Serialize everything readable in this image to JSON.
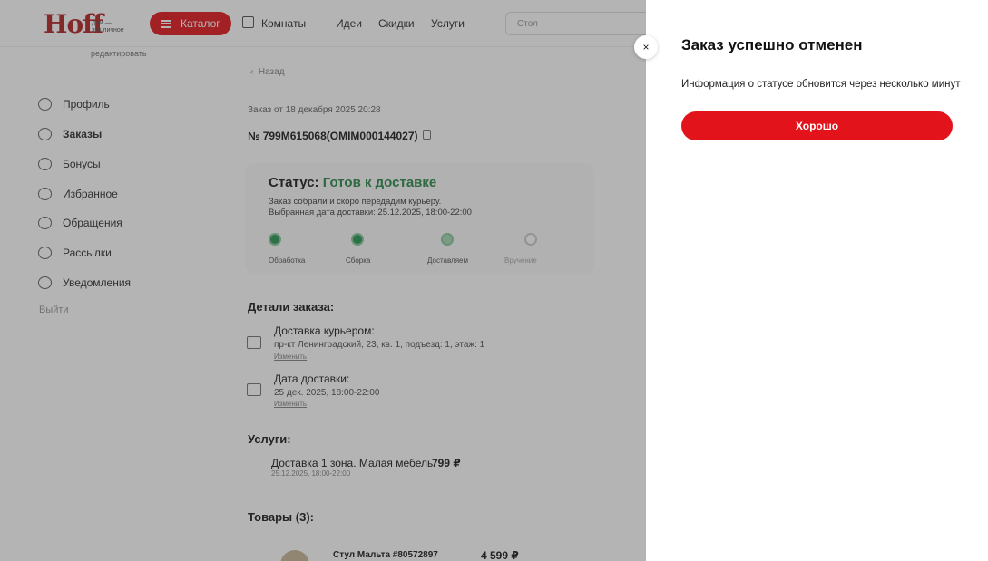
{
  "header": {
    "logo": "Hoff",
    "logo_tagline_1": "дом —",
    "logo_tagline_2": "это личное",
    "edit_link": "редактировать",
    "catalog_label": "Каталог",
    "nav": [
      "Комнаты",
      "Идеи",
      "Скидки",
      "Услуги"
    ],
    "search_placeholder": "Стол"
  },
  "sidebar": {
    "items": [
      {
        "label": "Профиль",
        "icon": "user-icon"
      },
      {
        "label": "Заказы",
        "icon": "cart-icon"
      },
      {
        "label": "Бонусы",
        "icon": "ruble-icon"
      },
      {
        "label": "Избранное",
        "icon": "heart-icon"
      },
      {
        "label": "Обращения",
        "icon": "chat-icon"
      },
      {
        "label": "Рассылки",
        "icon": "mail-icon"
      },
      {
        "label": "Уведомления",
        "icon": "bell-icon"
      }
    ],
    "active": "Заказы",
    "logout": "Выйти"
  },
  "order": {
    "back": "Назад",
    "date": "Заказ от 18 декабря 2025 20:28",
    "number": "№ 799M615068(OMIM000144027)",
    "status_label": "Статус:",
    "status_value": "Готов к доставке",
    "status_desc_1": "Заказ собрали и скоро передадим курьеру.",
    "status_desc_2": "Выбранная дата доставки: 25.12.2025, 18:00-22:00",
    "steps": [
      "Обработка",
      "Сборка",
      "Доставляем",
      "Вручение"
    ],
    "details_title": "Детали заказа:",
    "delivery_title": "Доставка курьером:",
    "delivery_address": "пр-кт Ленинградский, 23, кв. 1, подъезд: 1, этаж: 1",
    "delivery_change": "Изменить",
    "date_title": "Дата доставки:",
    "date_value": "25 дек. 2025, 18:00-22:00",
    "date_change": "Изменить",
    "services_title": "Услуги:",
    "service_name": "Доставка 1 зона. Малая мебель",
    "service_date": "25.12.2025, 18:00-22:00",
    "service_price": "799 ₽",
    "products_title": "Товары (3):",
    "product_name": "Стул Мальта #80572897",
    "product_price": "4 599 ₽"
  },
  "modal": {
    "title": "Заказ успешно отменен",
    "text": "Информация о статусе обновится через несколько минут",
    "button": "Хорошо",
    "close": "×"
  },
  "colors": {
    "accent": "#e3131b",
    "status_green": "#2e8a4e"
  }
}
